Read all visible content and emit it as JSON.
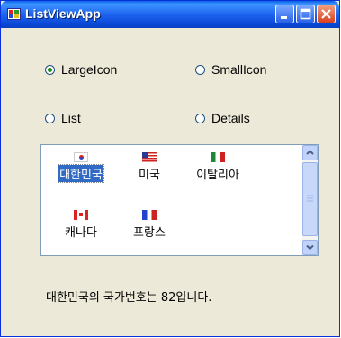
{
  "window": {
    "title": "ListViewApp",
    "controls": [
      "minimize-icon",
      "maximize-icon",
      "close-icon"
    ]
  },
  "view_modes": [
    {
      "label": "LargeIcon",
      "selected": true
    },
    {
      "label": "SmallIcon",
      "selected": false
    },
    {
      "label": "List",
      "selected": false
    },
    {
      "label": "Details",
      "selected": false
    }
  ],
  "listview": {
    "items": [
      {
        "label": "대한민국",
        "flag": "korea-flag-icon",
        "selected": true
      },
      {
        "label": "미국",
        "flag": "usa-flag-icon",
        "selected": false
      },
      {
        "label": "이탈리아",
        "flag": "italy-flag-icon",
        "selected": false
      },
      {
        "label": "캐나다",
        "flag": "canada-flag-icon",
        "selected": false
      },
      {
        "label": "프랑스",
        "flag": "france-flag-icon",
        "selected": false
      }
    ]
  },
  "status": {
    "text": "대한민국의 국가번호는 82입니다."
  },
  "colors": {
    "titlebar": "#0a5ee8",
    "selection": "#316ac5",
    "window_bg": "#ece9d8"
  }
}
